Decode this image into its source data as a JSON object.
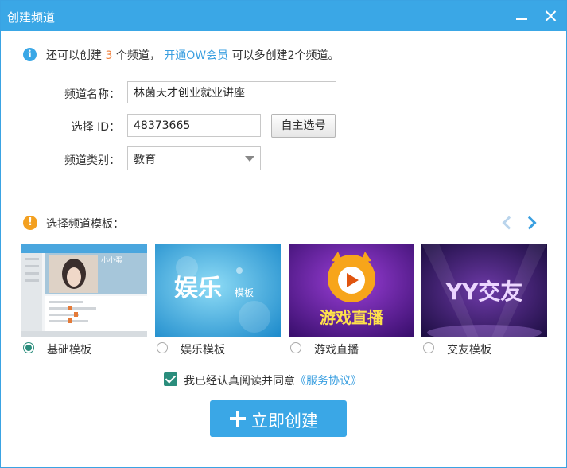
{
  "window": {
    "title": "创建频道"
  },
  "notice": {
    "prefix": "还可以创建",
    "count": "3",
    "middle": "个频道，",
    "link": "开通OW会员",
    "suffix": "可以多创建2个频道。"
  },
  "form": {
    "name_label": "频道名称：",
    "name_value": "林菌天才创业就业讲座",
    "id_label": "选择 ID：",
    "id_value": "48373665",
    "id_button": "自主选号",
    "category_label": "频道类别：",
    "category_value": "教育"
  },
  "templates": {
    "heading": "选择频道模板：",
    "items": [
      {
        "label": "基础模板",
        "selected": true,
        "preview_text": "小小蛋"
      },
      {
        "label": "娱乐模板",
        "selected": false,
        "preview_text": "娱乐",
        "preview_sub": "模板"
      },
      {
        "label": "游戏直播",
        "selected": false,
        "preview_text": "游戏直播"
      },
      {
        "label": "交友模板",
        "selected": false,
        "preview_text": "YY交友"
      }
    ]
  },
  "agreement": {
    "checked": true,
    "text": "我已经认真阅读并同意",
    "link": "《服务协议》"
  },
  "create_button": {
    "label": "立即创建"
  },
  "colors": {
    "accent": "#3aa7e6",
    "radio": "#2a8d7c",
    "highlight": "#f0803c",
    "warning": "#f3a020"
  }
}
